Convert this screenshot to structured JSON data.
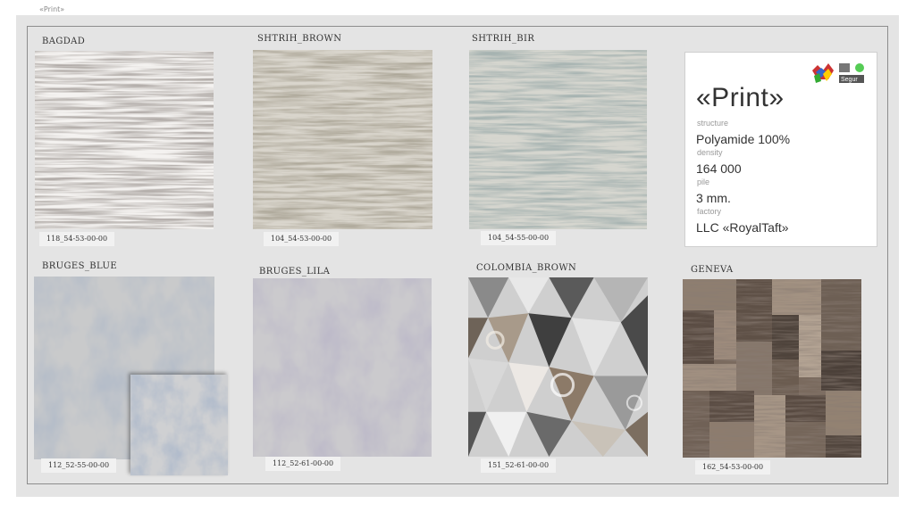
{
  "page_label": "«Print»",
  "rugs": [
    {
      "name": "BAGDAD",
      "code": "118_54-53-00-00"
    },
    {
      "name": "SHTRIH_BROWN",
      "code": "104_54-53-00-00"
    },
    {
      "name": "SHTRIH_BIR",
      "code": "104_54-55-00-00"
    },
    {
      "name": "BRUGES_BLUE",
      "code": "112_52-55-00-00"
    },
    {
      "name": "BRUGES_LILA",
      "code": "112_52-61-00-00"
    },
    {
      "name": "COLOMBIA_BROWN",
      "code": "151_52-61-00-00"
    },
    {
      "name": "GENEVA",
      "code": "162_54-53-00-00"
    }
  ],
  "info_card": {
    "title": "«Print»",
    "structure_label": "structure",
    "structure_value": "Polyamide 100%",
    "density_label": "density",
    "density_value": "164 000",
    "pile_label": "pile",
    "pile_value": "3 mm.",
    "factory_label": "factory",
    "factory_value": "LLC «RoyalTaft»",
    "logo_text": "Segur"
  }
}
